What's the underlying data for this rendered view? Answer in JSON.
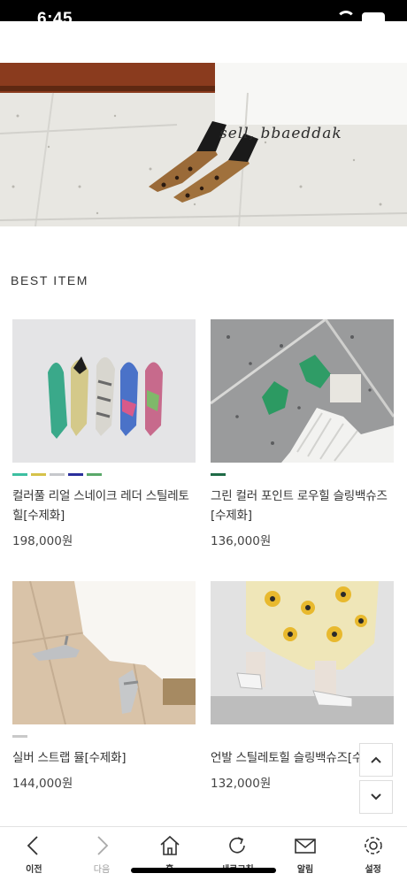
{
  "status_bar": {
    "time": "6:45"
  },
  "hero": {
    "caption": "sell, bbaeddak"
  },
  "section": {
    "title": "BEST ITEM"
  },
  "products": [
    {
      "name": "컬러풀 리얼 스네이크 레더 스틸레토힐[수제화]",
      "price": "198,000원",
      "swatches": [
        "#3dbfa1",
        "#d6c24a",
        "#c6c8cc",
        "#2a2f9c",
        "#5aa86a"
      ]
    },
    {
      "name": "그린 컬러 포인트 로우힐 슬링백슈즈[수제화]",
      "price": "136,000원",
      "swatches": [
        "#1f6b47"
      ]
    },
    {
      "name": "실버 스트랩 뮬[수제화]",
      "price": "144,000원",
      "swatches": [
        "#c9c9c9"
      ]
    },
    {
      "name": "언발 스틸레토힐 슬링백슈즈[수제화]",
      "price": "132,000원",
      "swatches": []
    }
  ],
  "nav": {
    "items": [
      {
        "label": "이전",
        "icon": "chevron-left-icon"
      },
      {
        "label": "다음",
        "icon": "chevron-right-icon"
      },
      {
        "label": "홈",
        "icon": "home-icon"
      },
      {
        "label": "새로고침",
        "icon": "refresh-icon"
      },
      {
        "label": "알림",
        "icon": "mail-icon"
      },
      {
        "label": "설정",
        "icon": "gear-icon"
      }
    ]
  }
}
